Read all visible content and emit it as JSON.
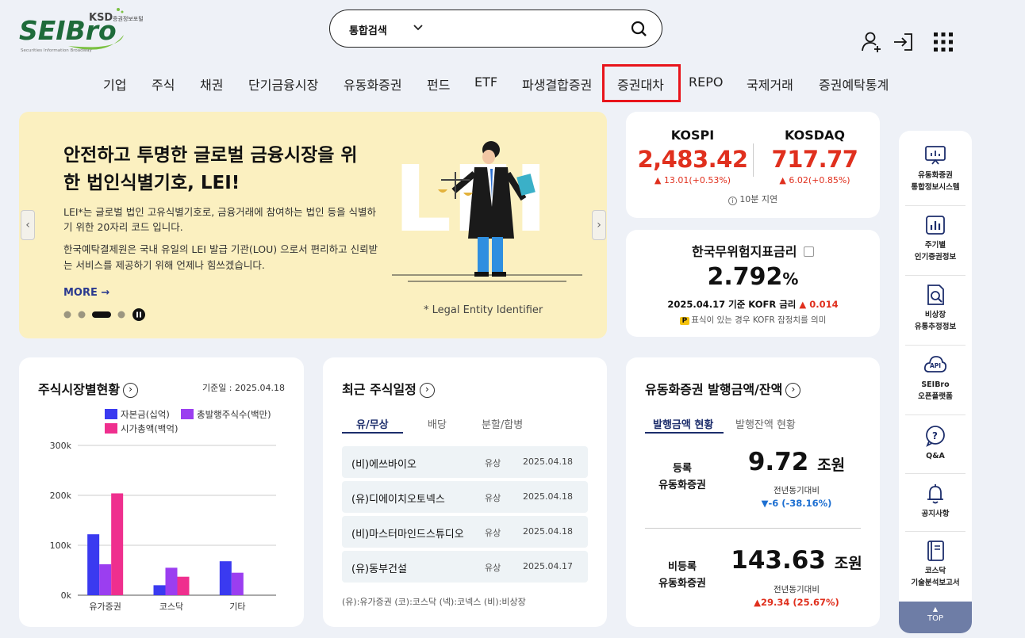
{
  "header": {
    "logo_text": "SEIBro",
    "logo_ksd": "KSD",
    "logo_sub_kr": "증권정보포털",
    "logo_sub_en": "Securities Information Broadway",
    "search_category": "통합검색",
    "icons": [
      "user-add-icon",
      "login-icon",
      "grid-menu-icon"
    ]
  },
  "nav": {
    "items": [
      "기업",
      "주식",
      "채권",
      "단기금융시장",
      "유동화증권",
      "펀드",
      "ETF",
      "파생결합증권",
      "증권대차",
      "REPO",
      "국제거래",
      "증권예탁통계"
    ],
    "highlighted": "증권대차",
    "highlight_color": "#e8141b"
  },
  "banner": {
    "title": "안전하고 투명한 글로벌 금융시장을 위한 법인식별기호, LEI!",
    "para1": "LEI*는 글로벌 법인 고유식별기호로, 금융거래에 참여하는 법인 등을 식별하기 위한 20자리 코드 입니다.",
    "para2": "한국예탁결제원은 국내 유일의 LEI 발급 기관(LOU) 으로서 편리하고 신뢰받는 서비스를 제공하기 위해 언제나 힘쓰겠습니다.",
    "more": "MORE →",
    "footnote": "* Legal Entity Identifier",
    "bg_text": "LEI",
    "slides_total": 4,
    "active_slide": 3
  },
  "indices": {
    "kospi": {
      "name": "KOSPI",
      "value": "2,483.42",
      "change": "▲ 13.01(+0.53%)"
    },
    "kosdaq": {
      "name": "KOSDAQ",
      "value": "717.77",
      "change": "▲ 6.02(+0.85%)"
    },
    "delay": "10분 지연"
  },
  "rate": {
    "title": "한국무위험지표금리",
    "value": "2.792",
    "unit": "%",
    "date_label": "2025.04.17 기준 KOFR 금리",
    "change": "▲ 0.014",
    "badge": "P",
    "note": "표식이 있는 경우 KOFR 잠정치를 의미"
  },
  "market": {
    "title": "주식시장별현황",
    "basedate": "기준일 : 2025.04.18",
    "legend": [
      "자본금(십억)",
      "총발행주식수(백만)",
      "시가총액(백억)"
    ],
    "colors": [
      "#3a3af0",
      "#9b3ef0",
      "#ef2f8e"
    ]
  },
  "chart_data": {
    "type": "bar",
    "categories": [
      "유가증권",
      "코스닥",
      "기타"
    ],
    "series": [
      {
        "name": "자본금(십억)",
        "values": [
          122,
          20,
          68
        ]
      },
      {
        "name": "총발행주식수(백만)",
        "values": [
          62,
          55,
          45
        ]
      },
      {
        "name": "시가총액(백억)",
        "values": [
          204,
          37,
          0
        ]
      }
    ],
    "yticks": [
      "0k",
      "100k",
      "200k",
      "300k"
    ],
    "ylim": [
      0,
      300
    ],
    "grid": true
  },
  "schedule": {
    "title": "최근 주식일정",
    "tabs": [
      "유/무상",
      "배당",
      "분할/합병"
    ],
    "rows": [
      {
        "name": "(비)에쓰바이오",
        "type": "유상",
        "date": "2025.04.18"
      },
      {
        "name": "(유)디에이치오토넥스",
        "type": "유상",
        "date": "2025.04.18"
      },
      {
        "name": "(비)마스터마인드스튜디오",
        "type": "유상",
        "date": "2025.04.18"
      },
      {
        "name": "(유)동부건설",
        "type": "유상",
        "date": "2025.04.17"
      }
    ],
    "footnote": "(유):유가증권   (코):코스닥   (넥):코넥스   (비):비상장"
  },
  "issuance": {
    "title": "유동화증권 발행금액/잔액",
    "tabs": [
      "발행금액 현황",
      "발행잔액 현황"
    ],
    "registered": {
      "label_1": "등록",
      "label_2": "유동화증권",
      "amount": "9.72",
      "unit": "조원",
      "yoy_label": "전년동기대비",
      "change": "▼-6 (-38.16%)"
    },
    "unregistered": {
      "label_1": "비등록",
      "label_2": "유동화증권",
      "amount": "143.63",
      "unit": "조원",
      "yoy_label": "전년동기대비",
      "change": "▲29.34 (25.67%)"
    }
  },
  "quick": {
    "items": [
      {
        "label_1": "유동화증권",
        "label_2": "통합정보시스템",
        "icon": "presentation-icon"
      },
      {
        "label_1": "주기별",
        "label_2": "인기증권정보",
        "icon": "bar-chart-icon"
      },
      {
        "label_1": "비상장",
        "label_2": "유통추정정보",
        "icon": "report-search-icon"
      },
      {
        "label_1": "SEIBro",
        "label_2": "오픈플랫폼",
        "icon": "api-cloud-icon"
      },
      {
        "label_1": "Q&A",
        "label_2": "",
        "icon": "question-chat-icon"
      },
      {
        "label_1": "공지사항",
        "label_2": "",
        "icon": "bell-icon"
      },
      {
        "label_1": "코스닥",
        "label_2": "기술분석보고서",
        "icon": "book-icon"
      }
    ],
    "top_arrow": "▲",
    "top": "TOP"
  }
}
